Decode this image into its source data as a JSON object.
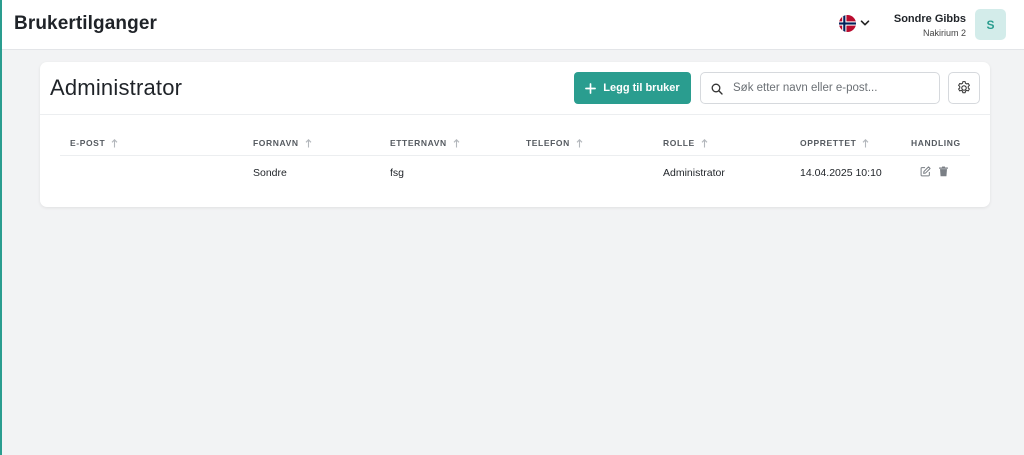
{
  "header": {
    "title": "Brukertilganger",
    "language": "Norsk",
    "user_name": "Sondre Gibbs",
    "user_org": "Nakirium 2",
    "avatar_initial": "S"
  },
  "card": {
    "title": "Administrator",
    "add_button_label": "Legg til bruker",
    "search_placeholder": "Søk etter navn eller e-post..."
  },
  "table": {
    "columns": [
      "E-POST",
      "FORNAVN",
      "ETTERNAVN",
      "TELEFON",
      "ROLLE",
      "OPPRETTET",
      "HANDLING"
    ],
    "rows": [
      {
        "email": "",
        "first_name": "Sondre",
        "last_name": "fsg",
        "phone": "",
        "role": "Administrator",
        "created": "14.04.2025 10:10"
      }
    ]
  },
  "colors": {
    "accent": "#2a9d8f",
    "avatar_bg": "#d3ecea",
    "page_bg": "#f2f3f4"
  },
  "icons": {
    "language": "norway-flag-icon",
    "add": "plus-icon",
    "search": "search-icon",
    "settings": "gear-icon",
    "sort": "sort-arrow-icon",
    "edit": "edit-icon",
    "delete": "trash-icon"
  }
}
